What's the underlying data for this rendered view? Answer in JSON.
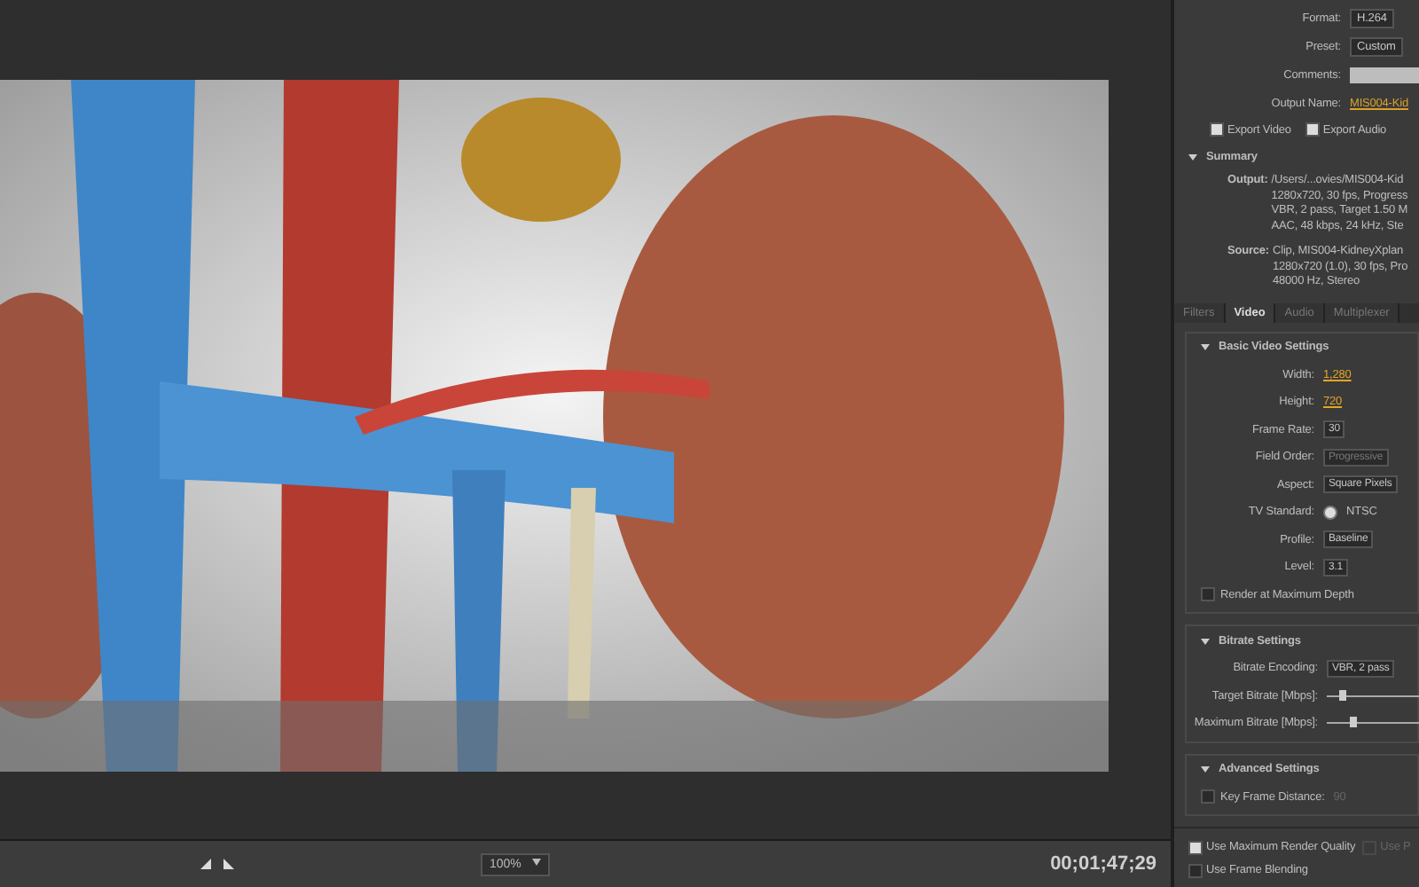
{
  "export_settings": {
    "rows": [
      {
        "label": "Format:",
        "value": "H.264",
        "kind": "dropdown"
      },
      {
        "label": "Preset:",
        "value": "Custom",
        "kind": "dropdown"
      },
      {
        "label": "Comments:",
        "value": "",
        "kind": "field"
      },
      {
        "label": "Output Name:",
        "value": "MIS004-Kid",
        "kind": "link"
      }
    ],
    "checks": [
      {
        "label": "Export Video",
        "checked": true
      },
      {
        "label": "Export Audio",
        "checked": true
      }
    ]
  },
  "summary": {
    "title": "Summary",
    "expanded": true,
    "groups": [
      {
        "label": "Output:",
        "lines": [
          "/Users/...ovies/MIS004-Kid",
          "1280x720, 30 fps, Progress",
          "VBR, 2 pass, Target 1.50 M",
          "AAC, 48 kbps, 24 kHz, Ste"
        ]
      },
      {
        "label": "Source:",
        "lines": [
          "Clip, MIS004-KidneyXplan",
          "1280x720 (1.0), 30 fps, Pro",
          "48000 Hz, Stereo"
        ]
      }
    ]
  },
  "tabs": [
    {
      "label": "Filters",
      "selected": false
    },
    {
      "label": "Video",
      "selected": true
    },
    {
      "label": "Audio",
      "selected": false
    },
    {
      "label": "Multiplexer",
      "selected": false
    }
  ],
  "sections": [
    {
      "title": "Basic Video Settings",
      "expanded": true,
      "rows": [
        {
          "kind": "number",
          "label": "Width:",
          "value": "1,280"
        },
        {
          "kind": "number",
          "label": "Height:",
          "value": "720"
        },
        {
          "kind": "dropdown",
          "label": "Frame Rate:",
          "value": "30",
          "disabled": false
        },
        {
          "kind": "dropdown",
          "label": "Field Order:",
          "value": "Progressive",
          "disabled": true
        },
        {
          "kind": "dropdown",
          "label": "Aspect:",
          "value": "Square Pixels",
          "disabled": false
        },
        {
          "kind": "radio",
          "label": "TV Standard:",
          "value": "NTSC",
          "selected": true
        },
        {
          "kind": "dropdown",
          "label": "Profile:",
          "value": "Baseline",
          "disabled": false
        },
        {
          "kind": "dropdown",
          "label": "Level:",
          "value": "3.1",
          "disabled": false
        },
        {
          "kind": "check",
          "label": "Render at Maximum Depth",
          "checked": false
        }
      ]
    },
    {
      "title": "Bitrate Settings",
      "expanded": true,
      "rows": [
        {
          "kind": "dropdown",
          "label": "Bitrate Encoding:",
          "value": "VBR, 2 pass",
          "disabled": false
        },
        {
          "kind": "slider",
          "label": "Target Bitrate [Mbps]:",
          "level": 0.15
        },
        {
          "kind": "slider",
          "label": "Maximum Bitrate [Mbps]:",
          "level": 0.25
        }
      ]
    },
    {
      "title": "Advanced Settings",
      "expanded": true,
      "rows": [
        {
          "kind": "check",
          "label": "Key Frame Distance:",
          "checked": false,
          "value": "90"
        }
      ]
    }
  ],
  "footer_checks": [
    [
      {
        "label": "Use Maximum Render Quality",
        "checked": true,
        "disabled": false
      },
      {
        "label": "Use P",
        "checked": false,
        "disabled": true
      }
    ],
    [
      {
        "label": "Use Frame Blending",
        "checked": false,
        "disabled": false
      }
    ]
  ],
  "preview": {
    "zoom": "100%",
    "timecode": "00;01;47;29"
  }
}
